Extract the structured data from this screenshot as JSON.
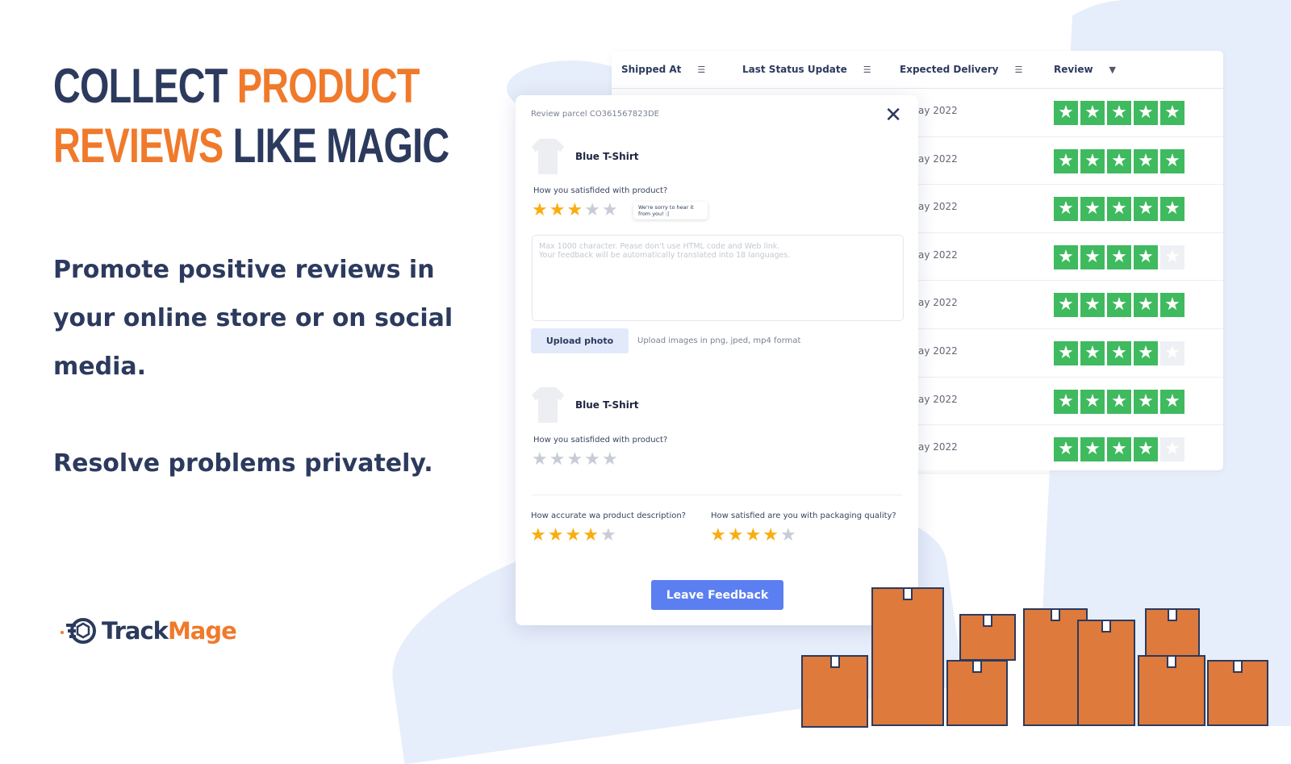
{
  "headline": {
    "part1": "COLLECT ",
    "part2": "PRODUCT",
    "part3": "REVIEWS",
    "part4": " LIKE MAGIC"
  },
  "promo": "Promote positive reviews in your online store or on social media.",
  "resolve": "Resolve problems privately.",
  "logo": {
    "part1": "Track",
    "part2": "Mage"
  },
  "colors": {
    "navy": "#2c3a5e",
    "orange": "#f07a2b",
    "green": "#3fba5f",
    "star": "#f9ad10",
    "button": "#5b7ff0"
  },
  "table": {
    "headers": [
      "Shipped At",
      "Last Status Update",
      "Expected Delivery",
      "Review"
    ],
    "rows": [
      {
        "date": "ay 2022",
        "rating": 5
      },
      {
        "date": "ay 2022",
        "rating": 5
      },
      {
        "date": "ay 2022",
        "rating": 5
      },
      {
        "date": "ay 2022",
        "rating": 4
      },
      {
        "date": "ay 2022",
        "rating": 5
      },
      {
        "date": "ay 2022",
        "rating": 4
      },
      {
        "date": "ay 2022",
        "rating": 5
      },
      {
        "date": "ay 2022",
        "rating": 4
      }
    ]
  },
  "modal": {
    "title": "Review parcel CO361567823DE",
    "products": [
      {
        "name": "Blue T-Shirt",
        "question": "How you satisfided with product?",
        "rating": 3,
        "tooltip": "We're sorry to hear it from you! :|"
      },
      {
        "name": "Blue T-Shirt",
        "question": "How you satisfided with product?",
        "rating": 0
      }
    ],
    "placeholder": "Max 1000 character. Pease don't use HTML code and Web link.\nYour feedback will be automatically translated into 18 languages.",
    "upload_label": "Upload photo",
    "upload_hint": "Upload images in png, jped, mp4 format",
    "q_description": "How accurate wa product description?",
    "q_description_rating": 4,
    "q_packaging": "How satisfied are you with packaging quality?",
    "q_packaging_rating": 4,
    "submit": "Leave Feedback"
  }
}
